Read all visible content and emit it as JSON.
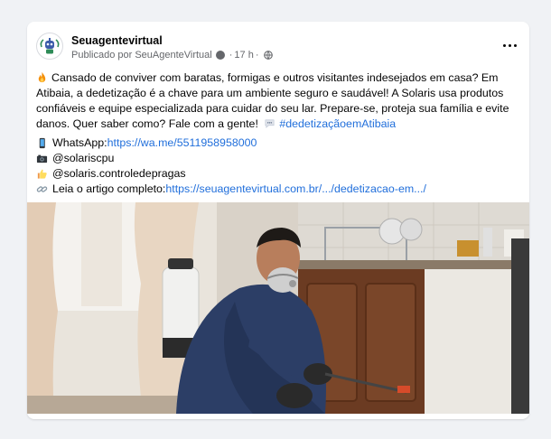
{
  "post": {
    "author": "Seuagentevirtual",
    "published_by": "Publicado por SeuAgenteVirtual",
    "time": "17 h",
    "body_segments": {
      "text": "Cansado de conviver com baratas, formigas e outros visitantes indesejados em casa? Em Atibaia, a dedetização é a chave para um ambiente seguro e saudável! A Solaris usa produtos confiáveis e equipe especializada para cuidar do seu lar. Prepare-se, proteja sua família e evite danos. Quer saber como? Fale com a gente!",
      "hashtag": "#dedetizaçãoemAtibaia"
    },
    "contacts": [
      {
        "icon": "phone-icon",
        "label": "WhatsApp: ",
        "link": "https://wa.me/5511958958000"
      },
      {
        "icon": "camera-icon",
        "label": "@solariscpu",
        "link": ""
      },
      {
        "icon": "thumbs-up-icon",
        "label": "@solaris.controledepragas",
        "link": ""
      },
      {
        "icon": "link-icon",
        "label": "Leia o artigo completo: ",
        "link": "https://seuagentevirtual.com.br/.../dedetizacao-em.../"
      }
    ]
  },
  "colors": {
    "background": "#f0f2f5",
    "card": "#ffffff",
    "link": "#216fdb",
    "secondary_text": "#65676b"
  }
}
